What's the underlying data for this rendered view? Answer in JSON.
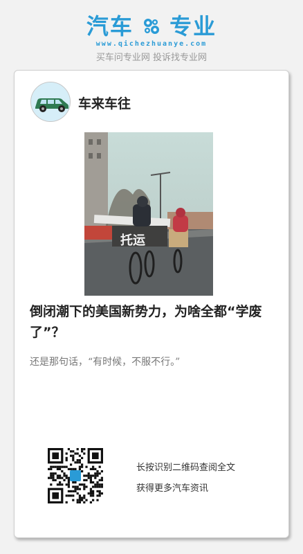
{
  "header": {
    "brand_left": "汽车",
    "brand_right": "专业",
    "domain": "www.qichezhuanye.com",
    "slogan": "买车问专业网 投诉找专业网",
    "brand_color": "#2a9bd6",
    "gear_icon": "gear-icon"
  },
  "card": {
    "account_name": "车来车往",
    "avatar_icon": "car-icon",
    "article_title": "倒闭潮下的美国新势力，为啥全都“学废了”？",
    "excerpt": "还是那句话，“有时候，不服不行。”",
    "qr_line1": "长按识别二维码查阅全文",
    "qr_line2": "获得更多汽车资讯",
    "photo_sign": "托运"
  }
}
